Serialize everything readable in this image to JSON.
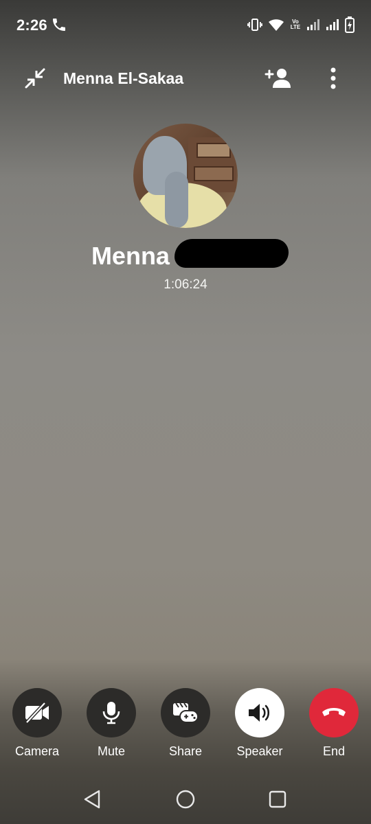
{
  "status_bar": {
    "time": "2:26",
    "icons": [
      "call-icon",
      "vibrate-icon",
      "wifi-icon",
      "volte-icon",
      "signal-icon",
      "signal-icon",
      "battery-charging-icon"
    ],
    "volte_top": "Vo",
    "volte_bottom": "LTE"
  },
  "header": {
    "title": "Menna El-Sakaa",
    "minimize_icon": "minimize-arrows-icon",
    "add_person_icon": "add-person-icon",
    "more_icon": "more-vertical-icon"
  },
  "contact": {
    "name": "Menna El-Sakaa",
    "duration": "1:06:24"
  },
  "controls": [
    {
      "label": "Camera",
      "icon": "camera-off-icon"
    },
    {
      "label": "Mute",
      "icon": "microphone-icon"
    },
    {
      "label": "Share",
      "icon": "share-activity-icon"
    },
    {
      "label": "Speaker",
      "icon": "speaker-icon",
      "active": true
    },
    {
      "label": "End",
      "icon": "end-call-icon"
    }
  ],
  "colors": {
    "end_call": "#e0283a",
    "control_bg": "#2c2b29",
    "speaker_active_bg": "#ffffff"
  },
  "nav": [
    "back-icon",
    "home-icon",
    "recents-icon"
  ]
}
